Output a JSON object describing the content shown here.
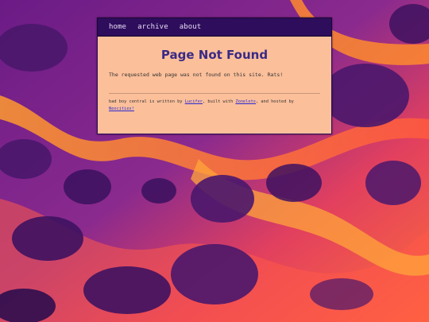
{
  "nav": {
    "items": [
      "home",
      "archive",
      "about"
    ]
  },
  "page": {
    "title": "Page Not Found",
    "message": "The requested web page was not found on this site. Rats!"
  },
  "footer": {
    "t1": "bad boy central is written by ",
    "link1": "Lucifer",
    "t2": ", built with ",
    "link2": "Zonelets",
    "t3": ", and hosted by ",
    "link3": "Neocities!"
  },
  "colors": {
    "nav_bg": "#2e0d5c",
    "card_bg": "#fbbf9a",
    "title": "#3a2a86",
    "link": "#2a2ad0"
  }
}
